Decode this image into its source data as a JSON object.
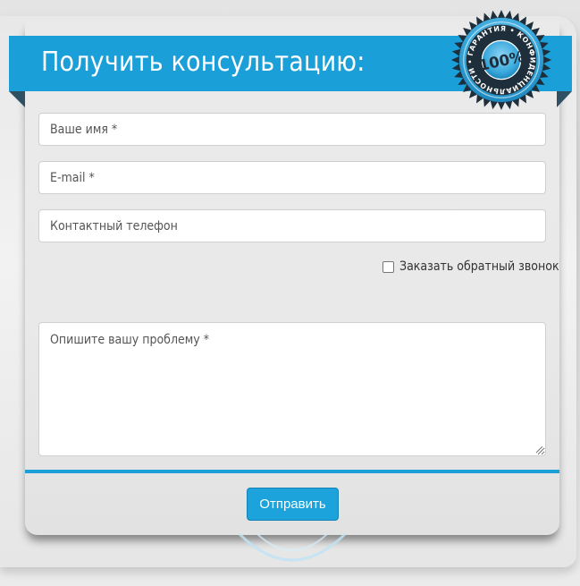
{
  "form": {
    "title": "Получить консультацию:",
    "seal": {
      "ring_text": "ГАРАНТИЯ • КОНФИДЕНЦИАЛЬНОСТИ •",
      "center_text": "100%"
    },
    "fields": {
      "name_placeholder": "Ваше имя *",
      "email_placeholder": "E-mail *",
      "phone_placeholder": "Контактный телефон"
    },
    "callback_label": "Заказать обратный звонок",
    "callback_checked": false,
    "problem_placeholder": "Опишите вашу проблему *",
    "submit_label": "Отправить"
  },
  "colors": {
    "accent": "#1a9fd9",
    "ribbon_fold": "#2f4f63",
    "seal_dark": "#1e2e3a",
    "panel": "#eaeaea"
  }
}
